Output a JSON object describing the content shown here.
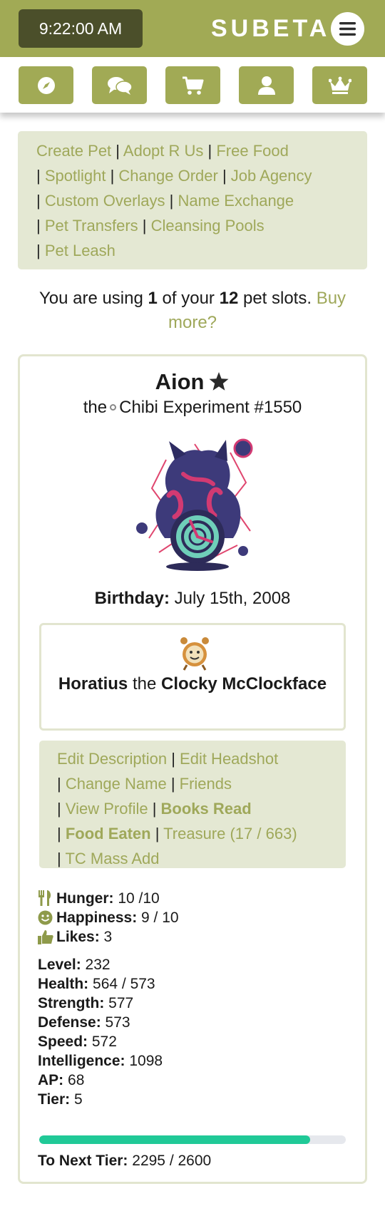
{
  "header": {
    "clock": "9:22:00 AM",
    "brand": "SUBETA",
    "menu_icon": "hamburger-icon",
    "accent_color": "#a1aa55",
    "nav_icons": [
      "compass-icon",
      "chat-icon",
      "cart-icon",
      "user-icon",
      "crown-icon"
    ]
  },
  "pet_links": [
    "Create Pet",
    "Adopt R Us",
    "Free Food",
    "Spotlight",
    "Change Order",
    "Job Agency",
    "Custom Overlays",
    "Name Exchange",
    "Pet Transfers",
    "Cleansing Pools",
    "Pet Leash"
  ],
  "slots": {
    "prefix": "You are using ",
    "used": "1",
    "middle": " of your ",
    "total": "12",
    "suffix": " pet slots. ",
    "buy_link": "Buy more?"
  },
  "pet": {
    "name": "Aion",
    "species_prefix": "the",
    "species": "Chibi Experiment #1550",
    "birthday_label": "Birthday:",
    "birthday": "July 15th, 2008",
    "companion": {
      "name": "Horatius",
      "connector": "the",
      "species": "Clocky McClockface"
    },
    "action_links": [
      "Edit Description",
      "Edit Headshot",
      "Change Name",
      "Friends",
      "View Profile",
      "Books Read",
      "Food Eaten",
      "Treasure (17 / 663)",
      "TC Mass Add"
    ],
    "mood": {
      "hunger_label": "Hunger:",
      "hunger": "10 /10",
      "happiness_label": "Happiness:",
      "happiness": "9 / 10",
      "likes_label": "Likes:",
      "likes": "3"
    },
    "stats": {
      "level_label": "Level:",
      "level": "232",
      "health_label": "Health:",
      "health": "564 / 573",
      "strength_label": "Strength:",
      "strength": "577",
      "defense_label": "Defense:",
      "defense": "573",
      "speed_label": "Speed:",
      "speed": "572",
      "intelligence_label": "Intelligence:",
      "intelligence": "1098",
      "ap_label": "AP:",
      "ap": "68",
      "tier_label": "Tier:",
      "tier": "5"
    },
    "tier_progress": {
      "label": "To Next Tier:",
      "value": "2295 / 2600",
      "fraction": 0.883,
      "color": "#20c997"
    }
  }
}
